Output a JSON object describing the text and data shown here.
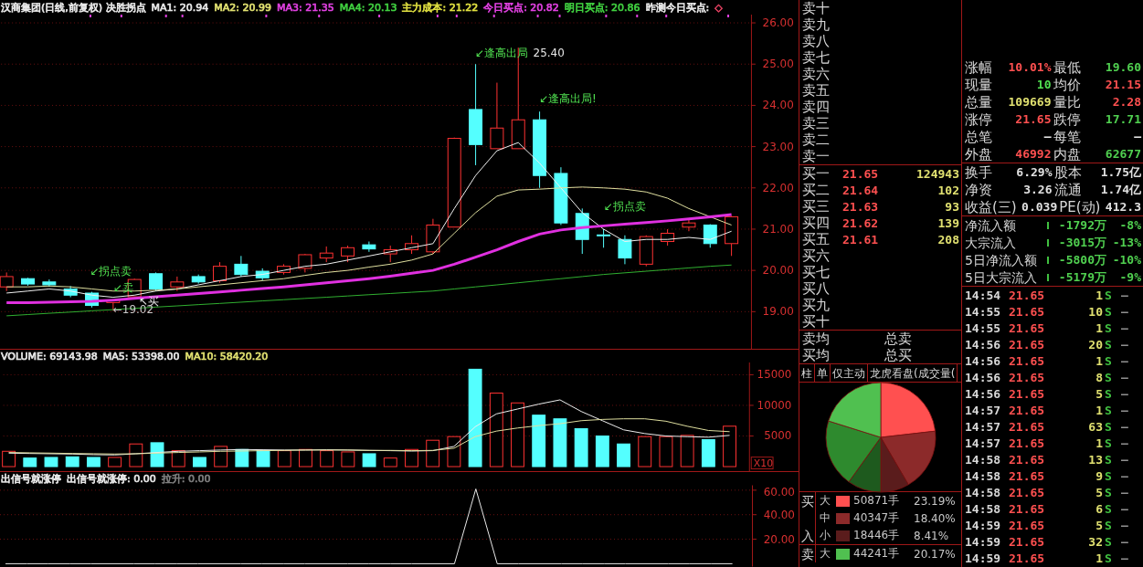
{
  "price_panel": {
    "header": [
      {
        "text": "汉商集团(日线,前复权) 决胜拐点",
        "color": "#e8e8e8"
      },
      {
        "text": "MA1: 20.94",
        "color": "#e8e8e8"
      },
      {
        "text": "MA2: 20.99",
        "color": "#e0e070"
      },
      {
        "text": "MA3: 21.35",
        "color": "#e040e0"
      },
      {
        "text": "MA4: 20.13",
        "color": "#40d040"
      },
      {
        "text": "主力成本: 21.22",
        "color": "#e0e040"
      },
      {
        "text": "今日买点: 20.82",
        "color": "#e040e0"
      },
      {
        "text": "明日买点: 20.86",
        "color": "#40d040"
      },
      {
        "text": "昨测今日买点:",
        "color": "#e8e8e8"
      },
      {
        "text": "◇",
        "color": "#e04060"
      }
    ],
    "chart_data": {
      "type": "candlestick",
      "grid": true,
      "ylim": [
        18.1,
        26.2
      ],
      "ohlc": [
        [
          19.6,
          19.95,
          19.5,
          19.85
        ],
        [
          19.8,
          19.82,
          19.63,
          19.67
        ],
        [
          19.72,
          19.78,
          19.6,
          19.65
        ],
        [
          19.55,
          19.62,
          19.35,
          19.4
        ],
        [
          19.45,
          19.48,
          19.1,
          19.15
        ],
        [
          19.22,
          19.3,
          19.02,
          19.28
        ],
        [
          19.36,
          19.8,
          19.3,
          19.78
        ],
        [
          19.92,
          19.95,
          19.5,
          19.55
        ],
        [
          19.6,
          19.85,
          19.5,
          19.72
        ],
        [
          19.85,
          19.9,
          19.68,
          19.72
        ],
        [
          19.75,
          20.2,
          19.7,
          20.1
        ],
        [
          20.15,
          20.35,
          19.85,
          19.9
        ],
        [
          19.98,
          20.05,
          19.75,
          19.82
        ],
        [
          19.95,
          20.15,
          19.9,
          20.1
        ],
        [
          20.05,
          20.4,
          19.95,
          20.38
        ],
        [
          20.3,
          20.58,
          20.2,
          20.42
        ],
        [
          20.35,
          20.6,
          20.2,
          20.55
        ],
        [
          20.62,
          20.7,
          20.45,
          20.52
        ],
        [
          20.4,
          20.6,
          20.2,
          20.5
        ],
        [
          20.5,
          20.85,
          20.4,
          20.65
        ],
        [
          20.45,
          21.25,
          20.4,
          21.1
        ],
        [
          21.05,
          23.22,
          21.05,
          23.2
        ],
        [
          23.9,
          25.0,
          22.55,
          23.05
        ],
        [
          22.95,
          24.55,
          22.95,
          23.45
        ],
        [
          22.95,
          25.4,
          22.95,
          23.65
        ],
        [
          23.65,
          23.85,
          22.0,
          22.3
        ],
        [
          22.35,
          22.5,
          21.1,
          21.15
        ],
        [
          21.38,
          21.5,
          20.4,
          20.75
        ],
        [
          20.86,
          21.0,
          20.55,
          20.84
        ],
        [
          20.75,
          20.85,
          20.15,
          20.3
        ],
        [
          20.15,
          20.85,
          20.1,
          20.82
        ],
        [
          20.7,
          21.0,
          20.6,
          20.9
        ],
        [
          21.05,
          21.25,
          20.95,
          21.15
        ],
        [
          21.1,
          21.12,
          20.55,
          20.65
        ],
        [
          20.65,
          21.32,
          20.35,
          21.3
        ]
      ],
      "yticks": [
        {
          "value": 26,
          "label": "26.00"
        },
        {
          "value": 25,
          "label": "25.00"
        },
        {
          "value": 24,
          "label": "24.00"
        },
        {
          "value": 23,
          "label": "23.00"
        },
        {
          "value": 22,
          "label": "22.00"
        },
        {
          "value": 21,
          "label": "21.00"
        },
        {
          "value": 20,
          "label": "20.00"
        },
        {
          "value": 19,
          "label": "19.00"
        }
      ],
      "series": [
        {
          "type": "line",
          "color": "#f0f0f0",
          "values": [
            19.45,
            19.5,
            19.55,
            19.5,
            19.4,
            19.35,
            19.4,
            19.5,
            19.55,
            19.65,
            19.75,
            19.85,
            19.9,
            20.0,
            20.1,
            20.15,
            20.25,
            20.35,
            20.45,
            20.55,
            20.65,
            21.5,
            22.3,
            22.9,
            23.1,
            22.6,
            22.0,
            21.4,
            21.0,
            20.7,
            20.75,
            20.75,
            20.8,
            20.75,
            20.95
          ]
        },
        {
          "type": "line",
          "color": "#e0e0a0",
          "values": [
            19.6,
            19.6,
            19.62,
            19.6,
            19.55,
            19.5,
            19.5,
            19.52,
            19.55,
            19.6,
            19.65,
            19.7,
            19.75,
            19.8,
            19.88,
            19.95,
            20.0,
            20.08,
            20.15,
            20.25,
            20.4,
            20.9,
            21.4,
            21.8,
            21.95,
            21.97,
            22.0,
            22.02,
            22.0,
            21.97,
            21.9,
            21.75,
            21.5,
            21.3,
            21.1
          ]
        },
        {
          "type": "line",
          "color": "#e030e0",
          "values": [
            19.22,
            19.22,
            19.23,
            19.24,
            19.25,
            19.28,
            19.32,
            19.36,
            19.4,
            19.44,
            19.48,
            19.52,
            19.56,
            19.6,
            19.65,
            19.7,
            19.75,
            19.8,
            19.86,
            19.93,
            20.0,
            20.15,
            20.32,
            20.5,
            20.7,
            20.88,
            20.98,
            21.04,
            21.08,
            21.12,
            21.16,
            21.2,
            21.25,
            21.3,
            21.35
          ]
        },
        {
          "type": "line",
          "color": "#30b030",
          "values": [
            18.9,
            18.93,
            18.96,
            18.99,
            19.02,
            19.05,
            19.08,
            19.11,
            19.14,
            19.17,
            19.2,
            19.23,
            19.26,
            19.29,
            19.32,
            19.35,
            19.38,
            19.41,
            19.44,
            19.47,
            19.5,
            19.55,
            19.6,
            19.65,
            19.7,
            19.75,
            19.8,
            19.85,
            19.9,
            19.94,
            19.98,
            20.02,
            20.06,
            20.1,
            20.13
          ]
        }
      ],
      "annotations": [
        "↙拐点卖",
        "↙卖",
        "↖买",
        "←19.02",
        "↙逢高出局",
        "25.40",
        "↙逢高出局!",
        "↙拐点卖"
      ]
    }
  },
  "volume_panel": {
    "header": [
      {
        "text": "VOLUME: 69143.98",
        "color": "#e8e8e8"
      },
      {
        "text": "MA5: 53398.00",
        "color": "#e8e8e8"
      },
      {
        "text": "MA10: 58420.20",
        "color": "#e0e070"
      }
    ],
    "unit_label": "X10",
    "chart_data": {
      "type": "bar",
      "grid": true,
      "ylim": [
        0,
        17000
      ],
      "yticks": [
        {
          "value": 15000,
          "label": "15000"
        },
        {
          "value": 10000,
          "label": "10000"
        },
        {
          "value": 5000,
          "label": "5000"
        }
      ],
      "series": [
        {
          "type": "bar",
          "color": "#ff3232",
          "values": [
            2500,
            null,
            null,
            null,
            null,
            1500,
            3700,
            null,
            2600,
            null,
            3300,
            null,
            null,
            2600,
            2800,
            2600,
            2400,
            null,
            1400,
            2800,
            4300,
            4900,
            null,
            12000,
            10400,
            null,
            null,
            null,
            null,
            null,
            4900,
            4900,
            5100,
            null,
            6600
          ]
        },
        {
          "type": "bar",
          "color": "#54ffff",
          "values": [
            null,
            1400,
            1500,
            1600,
            1500,
            null,
            null,
            3900,
            null,
            1500,
            null,
            2800,
            2600,
            null,
            null,
            null,
            null,
            2100,
            null,
            null,
            null,
            null,
            15900,
            null,
            null,
            8400,
            7800,
            6200,
            5000,
            3700,
            null,
            null,
            null,
            4400,
            null
          ]
        },
        {
          "type": "line",
          "color": "#f0f0f0",
          "values": [
            2200,
            2150,
            2100,
            2050,
            1950,
            1900,
            2100,
            2300,
            2500,
            2600,
            2700,
            2800,
            2750,
            2700,
            2700,
            2750,
            2700,
            2650,
            2600,
            2550,
            2600,
            3300,
            6500,
            8600,
            9400,
            10200,
            10900,
            9000,
            7500,
            6000,
            5400,
            5000,
            4900,
            4800,
            5100
          ]
        },
        {
          "type": "line",
          "color": "#e0e0a0",
          "values": [
            2300,
            2250,
            2200,
            2150,
            2100,
            2050,
            2100,
            2200,
            2300,
            2400,
            2500,
            2550,
            2600,
            2650,
            2700,
            2700,
            2700,
            2650,
            2650,
            2600,
            2650,
            3000,
            4900,
            5800,
            6300,
            6700,
            7000,
            7500,
            7700,
            7800,
            7800,
            7400,
            6600,
            5900,
            5700
          ]
        }
      ]
    }
  },
  "indicator_panel": {
    "header": [
      {
        "text": "出信号就涨停",
        "color": "#e8e8e8"
      },
      {
        "text": "出信号就涨停: 0.00",
        "color": "#e8e8e8"
      },
      {
        "text": "拉升: 0.00",
        "color": "#808080"
      }
    ],
    "chart_data": {
      "type": "line",
      "grid": true,
      "ylim": [
        -2.3,
        64
      ],
      "yticks": [
        {
          "value": 60,
          "label": "60.00"
        },
        {
          "value": 40,
          "label": "40.00"
        },
        {
          "value": 20,
          "label": "20.00"
        }
      ],
      "series": [
        {
          "color": "#e8e8e8",
          "values": [
            0,
            0,
            0,
            0,
            0,
            0,
            0,
            0,
            0,
            0,
            0,
            0,
            0,
            0,
            0,
            0,
            0,
            0,
            0,
            0,
            0,
            0,
            61,
            0,
            0,
            0,
            0,
            0,
            0,
            0,
            0,
            0,
            0,
            0,
            0
          ]
        }
      ]
    }
  },
  "order_book": {
    "asks": [
      {
        "label": "卖十"
      },
      {
        "label": "卖九"
      },
      {
        "label": "卖八"
      },
      {
        "label": "卖七"
      },
      {
        "label": "卖六"
      },
      {
        "label": "卖五"
      },
      {
        "label": "卖四"
      },
      {
        "label": "卖三"
      },
      {
        "label": "卖二"
      },
      {
        "label": "卖一"
      }
    ],
    "bids": [
      {
        "label": "买一",
        "price": "21.65",
        "volume": "124943"
      },
      {
        "label": "买二",
        "price": "21.64",
        "volume": "102"
      },
      {
        "label": "买三",
        "price": "21.63",
        "volume": "93"
      },
      {
        "label": "买四",
        "price": "21.62",
        "volume": "139"
      },
      {
        "label": "买五",
        "price": "21.61",
        "volume": "208"
      },
      {
        "label": "买六"
      },
      {
        "label": "买七"
      },
      {
        "label": "买八"
      },
      {
        "label": "买九"
      },
      {
        "label": "买十"
      }
    ],
    "summary": [
      {
        "label": "卖均",
        "total_label": "总卖"
      },
      {
        "label": "买均",
        "total_label": "总买"
      }
    ]
  },
  "tabs": [
    {
      "label": "柱"
    },
    {
      "label": "单"
    },
    {
      "label": "仅主动"
    },
    {
      "label": "龙虎看盘(成交量("
    }
  ],
  "pie": {
    "chart_data": {
      "type": "pie",
      "values": [
        23.19,
        18.4,
        8.41,
        9.9,
        19.93,
        20.17
      ],
      "colors": [
        "#ff5050",
        "#8c2a2a",
        "#5a1c1c",
        "#1e5a1e",
        "#2e8a2e",
        "#50c050"
      ]
    }
  },
  "legend": [
    {
      "side": "买入",
      "rows": [
        {
          "size": "大",
          "color": "#ff5050",
          "amount": "50871手",
          "percent": "23.19%"
        },
        {
          "size": "中",
          "color": "#8c2a2a",
          "amount": "40347手",
          "percent": "18.40%"
        },
        {
          "size": "小",
          "color": "#5a1c1c",
          "amount": "18446手",
          "percent": "8.41%"
        }
      ]
    },
    {
      "side": "卖",
      "rows": [
        {
          "size": "大",
          "color": "#50c050",
          "amount": "44241手",
          "percent": "20.17%"
        }
      ]
    }
  ],
  "stats": [
    [
      {
        "label": "涨幅",
        "value": "10.01%",
        "color": "#ff5050"
      },
      {
        "label": "最低",
        "value": "19.60",
        "color": "#50d050"
      }
    ],
    [
      {
        "label": "现量",
        "value": "10",
        "color": "#50e050"
      },
      {
        "label": "均价",
        "value": "21.15",
        "color": "#ff5050"
      }
    ],
    [
      {
        "label": "总量",
        "value": "109669",
        "color": "#e0e070"
      },
      {
        "label": "量比",
        "value": "2.28",
        "color": "#ff5050"
      }
    ],
    [
      {
        "label": "涨停",
        "value": "21.65",
        "color": "#ff5050"
      },
      {
        "label": "跌停",
        "value": "17.71",
        "color": "#50d050"
      }
    ],
    [
      {
        "label": "总笔",
        "value": "–",
        "color": "#e8e8e8"
      },
      {
        "label": "每笔",
        "value": "–",
        "color": "#e8e8e8"
      }
    ],
    [
      {
        "label": "外盘",
        "value": "46992",
        "color": "#ff5050"
      },
      {
        "label": "内盘",
        "value": "62677",
        "color": "#50d050"
      }
    ]
  ],
  "capital": [
    [
      {
        "label": "换手",
        "value": "6.29%"
      },
      {
        "label": "股本",
        "value": "1.75亿"
      }
    ],
    [
      {
        "label": "净资",
        "value": "3.26"
      },
      {
        "label": "流通",
        "value": "1.74亿"
      }
    ],
    [
      {
        "label": "收益(三)",
        "value": "0.039"
      },
      {
        "label": "PE(动)",
        "value": "412.3"
      }
    ]
  ],
  "flows": [
    {
      "label": "净流入额",
      "amount": "-1792万",
      "percent": "-8%"
    },
    {
      "label": "大宗流入",
      "amount": "-3015万",
      "percent": "-13%"
    },
    {
      "label": "5日净流入额",
      "amount": "-5800万",
      "percent": "-10%"
    },
    {
      "label": "5日大宗流入",
      "amount": "-5179万",
      "percent": "-9%"
    }
  ],
  "ticks": [
    {
      "time": "14:54",
      "price": "21.65",
      "volume": "1",
      "side": "S",
      "flag": "–"
    },
    {
      "time": "14:55",
      "price": "21.65",
      "volume": "10",
      "side": "S",
      "flag": "–"
    },
    {
      "time": "14:55",
      "price": "21.65",
      "volume": "1",
      "side": "S",
      "flag": "–"
    },
    {
      "time": "14:56",
      "price": "21.65",
      "volume": "20",
      "side": "S",
      "flag": "–"
    },
    {
      "time": "14:56",
      "price": "21.65",
      "volume": "1",
      "side": "S",
      "flag": "–"
    },
    {
      "time": "14:56",
      "price": "21.65",
      "volume": "8",
      "side": "S",
      "flag": "–"
    },
    {
      "time": "14:56",
      "price": "21.65",
      "volume": "5",
      "side": "S",
      "flag": "–"
    },
    {
      "time": "14:57",
      "price": "21.65",
      "volume": "1",
      "side": "S",
      "flag": "–"
    },
    {
      "time": "14:57",
      "price": "21.65",
      "volume": "63",
      "side": "S",
      "flag": "–"
    },
    {
      "time": "14:57",
      "price": "21.65",
      "volume": "1",
      "side": "S",
      "flag": "–"
    },
    {
      "time": "14:58",
      "price": "21.65",
      "volume": "13",
      "side": "S",
      "flag": "–"
    },
    {
      "time": "14:58",
      "price": "21.65",
      "volume": "9",
      "side": "S",
      "flag": "–"
    },
    {
      "time": "14:58",
      "price": "21.65",
      "volume": "5",
      "side": "S",
      "flag": "–"
    },
    {
      "time": "14:58",
      "price": "21.65",
      "volume": "6",
      "side": "S",
      "flag": "–"
    },
    {
      "time": "14:59",
      "price": "21.65",
      "volume": "5",
      "side": "S",
      "flag": "–"
    },
    {
      "time": "14:59",
      "price": "21.65",
      "volume": "32",
      "side": "S",
      "flag": "–"
    },
    {
      "time": "14:59",
      "price": "21.65",
      "volume": "1",
      "side": "S",
      "flag": "–"
    }
  ]
}
